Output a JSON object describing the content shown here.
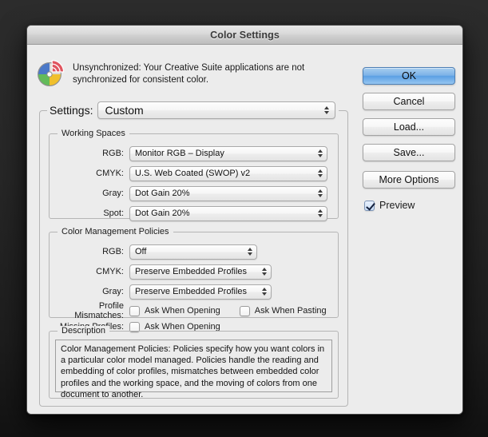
{
  "window": {
    "title": "Color Settings"
  },
  "warning": {
    "icon": "color-wheel-unsynchronized-icon",
    "line1": "Unsynchronized: Your Creative Suite applications are not",
    "line2": "synchronized for consistent color."
  },
  "settings": {
    "label": "Settings:",
    "value": "Custom"
  },
  "working_spaces": {
    "legend": "Working Spaces",
    "rows": [
      {
        "label": "RGB:",
        "value": "Monitor RGB – Display"
      },
      {
        "label": "CMYK:",
        "value": "U.S. Web Coated (SWOP) v2"
      },
      {
        "label": "Gray:",
        "value": "Dot Gain 20%"
      },
      {
        "label": "Spot:",
        "value": "Dot Gain 20%"
      }
    ]
  },
  "policies": {
    "legend": "Color Management Policies",
    "rows": [
      {
        "label": "RGB:",
        "value": "Off"
      },
      {
        "label": "CMYK:",
        "value": "Preserve Embedded Profiles"
      },
      {
        "label": "Gray:",
        "value": "Preserve Embedded Profiles"
      }
    ],
    "profile_mismatches": {
      "label": "Profile Mismatches:",
      "ask_when_opening": {
        "label": "Ask When Opening",
        "checked": false
      },
      "ask_when_pasting": {
        "label": "Ask When Pasting",
        "checked": false
      }
    },
    "missing_profiles": {
      "label": "Missing Profiles:",
      "ask_when_opening": {
        "label": "Ask When Opening",
        "checked": false
      }
    }
  },
  "description": {
    "legend": "Description",
    "text": "Color Management Policies:  Policies specify how you want colors in a particular color model managed.  Policies handle the reading and embedding of color profiles, mismatches between embedded color profiles and the working space, and the moving of colors from one document to another."
  },
  "buttons": {
    "ok": "OK",
    "cancel": "Cancel",
    "load": "Load...",
    "save": "Save...",
    "more_options": "More Options"
  },
  "preview": {
    "label": "Preview",
    "checked": true
  },
  "colors": {
    "default_button_accent": "#5ba0e4",
    "dialog_background": "#ececec",
    "desktop_background": "#262626",
    "wheel_blue": "#4a78c8",
    "wheel_green": "#63bb5a",
    "wheel_yellow": "#f0c02c",
    "wheel_red": "#e0555f"
  }
}
